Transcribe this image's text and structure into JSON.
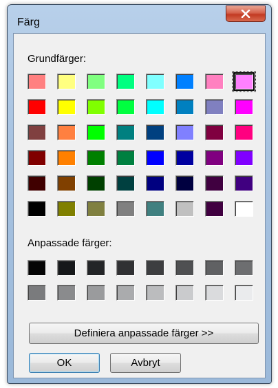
{
  "dialog": {
    "title": "Färg",
    "close_symbol": "×"
  },
  "basic_colors": {
    "label": "Grundfärger:",
    "selected_index": 7,
    "swatches": [
      "#ff8080",
      "#ffff80",
      "#80ff80",
      "#00ff80",
      "#80ffff",
      "#0080ff",
      "#ff80c0",
      "#ff80ff",
      "#ff0000",
      "#ffff00",
      "#80ff00",
      "#00ff40",
      "#00ffff",
      "#0080c0",
      "#8080c0",
      "#ff00ff",
      "#804040",
      "#ff8040",
      "#00ff00",
      "#008080",
      "#004080",
      "#8080ff",
      "#800040",
      "#ff0080",
      "#800000",
      "#ff8000",
      "#008000",
      "#008040",
      "#0000ff",
      "#0000a0",
      "#800080",
      "#8000ff",
      "#400000",
      "#804000",
      "#004000",
      "#004040",
      "#000080",
      "#000040",
      "#400040",
      "#400080",
      "#000000",
      "#808000",
      "#808040",
      "#808080",
      "#408080",
      "#c0c0c0",
      "#400040",
      "#ffffff"
    ]
  },
  "custom_colors": {
    "label": "Anpassade färger:",
    "swatches": [
      "#050505",
      "#16181a",
      "#232527",
      "#303133",
      "#3d3e40",
      "#4f5052",
      "#606163",
      "#6d6e70",
      "#7a7b7d",
      "#8a8b8d",
      "#9a9b9d",
      "#aaabad",
      "#bbbcbe",
      "#cacbcd",
      "#dadbdd",
      "#eaebed"
    ]
  },
  "buttons": {
    "define_custom": "Definiera anpassade färger >>",
    "ok": "OK",
    "cancel": "Avbryt"
  }
}
